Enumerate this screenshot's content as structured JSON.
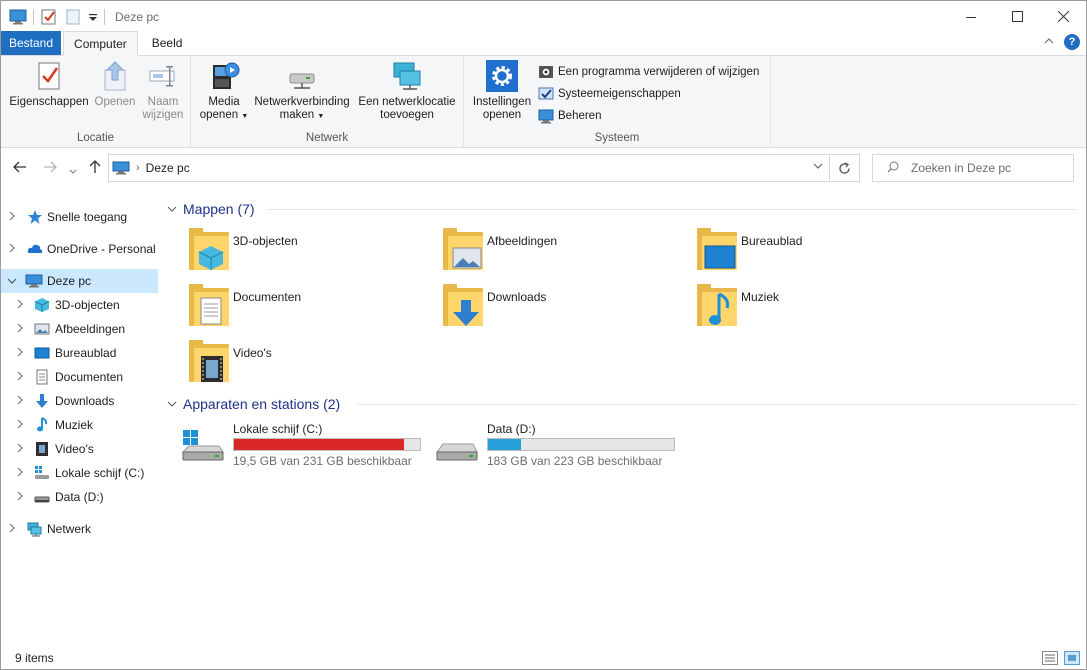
{
  "window": {
    "title": "Deze pc"
  },
  "tabs": [
    {
      "label": "Bestand"
    },
    {
      "label": "Computer"
    },
    {
      "label": "Beeld"
    }
  ],
  "ribbon": {
    "locatie": {
      "label": "Locatie",
      "eigenschappen": "Eigenschappen",
      "openen": "Openen",
      "naam_l1": "Naam",
      "naam_l2": "wijzigen"
    },
    "netwerk": {
      "label": "Netwerk",
      "media_l1": "Media",
      "media_l2": "openen",
      "netverb_l1": "Netwerkverbinding",
      "netverb_l2": "maken",
      "netlok_l1": "Een netwerklocatie",
      "netlok_l2": "toevoegen"
    },
    "systeem": {
      "label": "Systeem",
      "inst_l1": "Instellingen",
      "inst_l2": "openen",
      "verwijderen": "Een programma verwijderen of wijzigen",
      "syseig": "Systeemeigenschappen",
      "beheren": "Beheren"
    }
  },
  "address": {
    "path": "Deze pc",
    "search_placeholder": "Zoeken in Deze pc"
  },
  "nav": {
    "snelle": "Snelle toegang",
    "onedrive": "OneDrive - Personal",
    "dezepc": "Deze pc",
    "obj3d": "3D-objecten",
    "afbeeldingen": "Afbeeldingen",
    "bureaublad": "Bureaublad",
    "documenten": "Documenten",
    "downloads": "Downloads",
    "muziek": "Muziek",
    "videos": "Video's",
    "lokale": "Lokale schijf (C:)",
    "data": "Data (D:)",
    "netwerk": "Netwerk"
  },
  "content": {
    "mappen_header": "Mappen (7)",
    "apparaten_header": "Apparaten en stations (2)",
    "folders": {
      "obj3d": "3D-objecten",
      "afbeeldingen": "Afbeeldingen",
      "bureaublad": "Bureaublad",
      "documenten": "Documenten",
      "downloads": "Downloads",
      "muziek": "Muziek",
      "videos": "Video's"
    },
    "drives": {
      "c": {
        "name": "Lokale schijf (C:)",
        "free": "19,5 GB van 231 GB beschikbaar",
        "used_fraction": 0.916,
        "bar_color": "#da2626"
      },
      "d": {
        "name": "Data (D:)",
        "free": "183 GB van 223 GB beschikbaar",
        "used_fraction": 0.18,
        "bar_color": "#26a0da"
      }
    }
  },
  "status": {
    "items": "9 items"
  }
}
